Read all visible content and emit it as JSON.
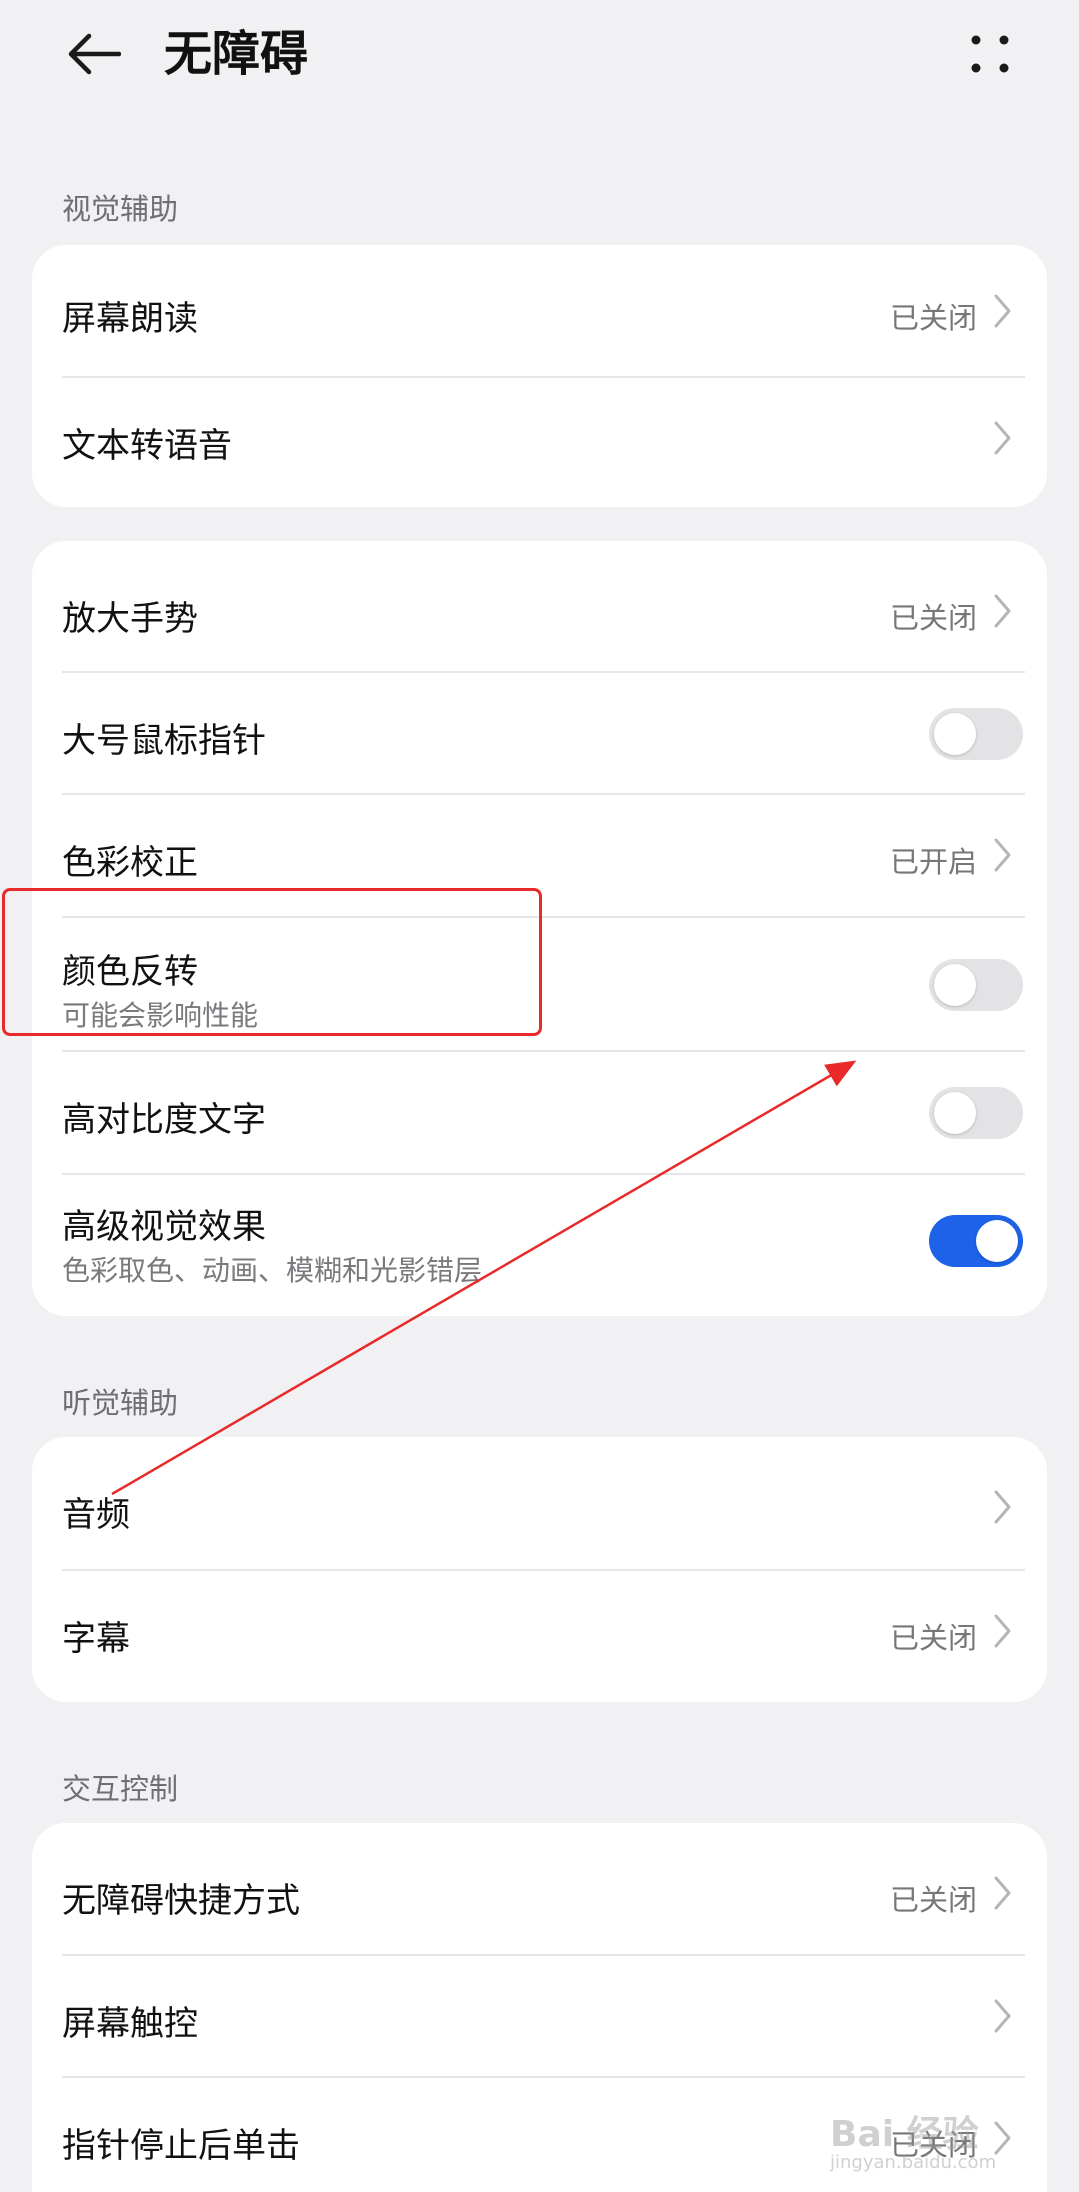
{
  "header": {
    "title": "无障碍"
  },
  "sections": {
    "visual": {
      "label": "视觉辅助",
      "card1": {
        "screen_reader": {
          "title": "屏幕朗读",
          "status": "已关闭"
        },
        "tts": {
          "title": "文本转语音"
        }
      },
      "card2": {
        "magnify": {
          "title": "放大手势",
          "status": "已关闭"
        },
        "large_pointer": {
          "title": "大号鼠标指针",
          "on": false
        },
        "color_correction": {
          "title": "色彩校正",
          "status": "已开启"
        },
        "color_inversion": {
          "title": "颜色反转",
          "subtitle": "可能会影响性能",
          "on": false
        },
        "high_contrast": {
          "title": "高对比度文字",
          "on": false
        },
        "advanced_visual": {
          "title": "高级视觉效果",
          "subtitle": "色彩取色、动画、模糊和光影错层",
          "on": true
        }
      }
    },
    "hearing": {
      "label": "听觉辅助",
      "audio": {
        "title": "音频"
      },
      "subtitles": {
        "title": "字幕",
        "status": "已关闭"
      }
    },
    "interaction": {
      "label": "交互控制",
      "shortcut": {
        "title": "无障碍快捷方式",
        "status": "已关闭"
      },
      "touch": {
        "title": "屏幕触控"
      },
      "dwell_click": {
        "title": "指针停止后单击",
        "status": "已关闭"
      }
    }
  },
  "watermark": {
    "text": "Bai 经验",
    "sub": "jingyan.baidu.com"
  },
  "colors": {
    "accent": "#1d62e8",
    "annotation": "#e82a2a",
    "background": "#f1f1f3"
  }
}
